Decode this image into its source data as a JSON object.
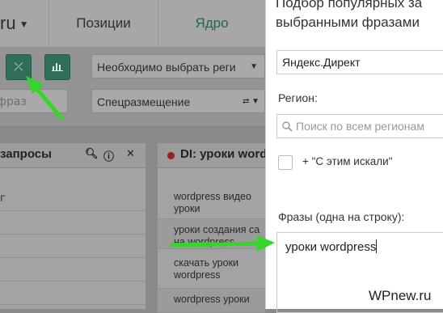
{
  "app": {
    "logo_suffix": "ru",
    "nav": {
      "positions": "Позиции",
      "core": "Ядро"
    }
  },
  "toolbar": {
    "region_select": "Необходимо выбрать реги",
    "placement_select": "Спецразмещение",
    "search_placeholder": "фраз"
  },
  "queries_panel": {
    "title": "запросы",
    "rows": [
      "г",
      "",
      "",
      "",
      ""
    ]
  },
  "di_panel": {
    "title": "DI: уроки word",
    "rows": [
      "wordpress видео уроки",
      "уроки создания са на wordpress",
      "скачать уроки wordpress",
      "wordpress уроки"
    ]
  },
  "modal": {
    "title_line1": "Подбор популярных за",
    "title_line2": "выбранными фразами",
    "source": "Яндекс.Директ",
    "region_label": "Регион:",
    "region_placeholder": "Поиск по всем регионам",
    "also_searched_label": "+ \"С этим искали\"",
    "phrases_label": "Фразы (одна на строку):",
    "phrases_value": "уроки wordpress"
  },
  "watermark": "WPnew.ru",
  "colors": {
    "arrow": "#34d62a",
    "accent": "#2f6e58",
    "overlay": "#8f8f8f"
  }
}
